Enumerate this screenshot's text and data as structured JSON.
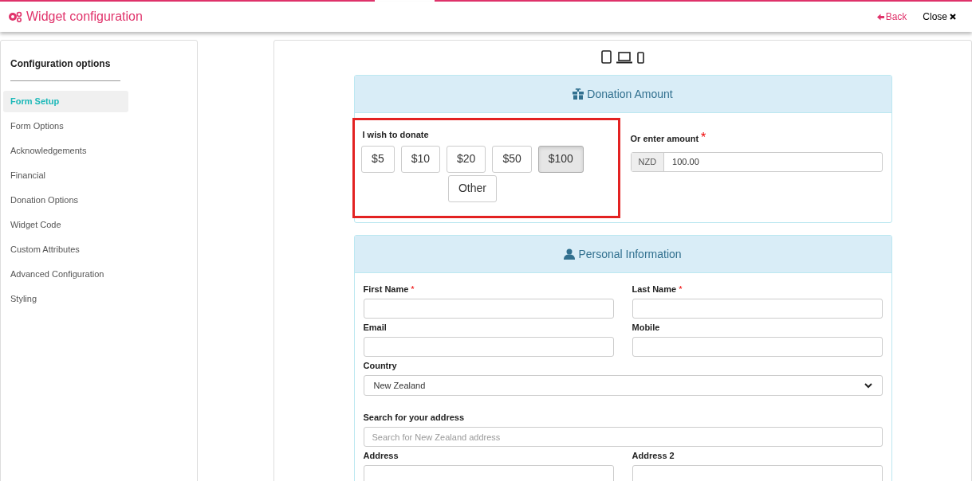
{
  "header": {
    "title": "Widget configuration",
    "back": "Back",
    "close": "Close"
  },
  "sidebar": {
    "title": "Configuration options",
    "items": [
      {
        "label": "Form Setup",
        "selected": true
      },
      {
        "label": "Form Options",
        "selected": false
      },
      {
        "label": "Acknowledgements",
        "selected": false
      },
      {
        "label": "Financial",
        "selected": false
      },
      {
        "label": "Donation Options",
        "selected": false
      },
      {
        "label": "Widget Code",
        "selected": false
      },
      {
        "label": "Custom Attributes",
        "selected": false
      },
      {
        "label": "Advanced Configuration",
        "selected": false
      },
      {
        "label": "Styling",
        "selected": false
      }
    ]
  },
  "donation": {
    "title": "Donation Amount",
    "label": "I wish to donate",
    "amounts": [
      {
        "label": "$5",
        "selected": false
      },
      {
        "label": "$10",
        "selected": false
      },
      {
        "label": "$20",
        "selected": false
      },
      {
        "label": "$50",
        "selected": false
      },
      {
        "label": "$100",
        "selected": true
      },
      {
        "label": "Other",
        "selected": false
      }
    ],
    "other_label": "Or enter amount",
    "required_mark": "*",
    "currency": "NZD",
    "value": "100.00"
  },
  "personal": {
    "title": "Personal Information",
    "fields": [
      {
        "kind": "text",
        "label": "First Name",
        "required_mark": "*"
      },
      {
        "kind": "text",
        "label": "Last Name",
        "required_mark": "*"
      },
      {
        "kind": "text",
        "label": "Email"
      },
      {
        "kind": "text",
        "label": "Mobile"
      },
      {
        "kind": "select",
        "label": "Country",
        "value": "New Zealand"
      },
      {
        "kind": "search",
        "label": "Search for your address",
        "placeholder": "Search for New Zealand address"
      },
      {
        "kind": "text",
        "label": "Address"
      },
      {
        "kind": "text",
        "label": "Address 2"
      }
    ]
  }
}
